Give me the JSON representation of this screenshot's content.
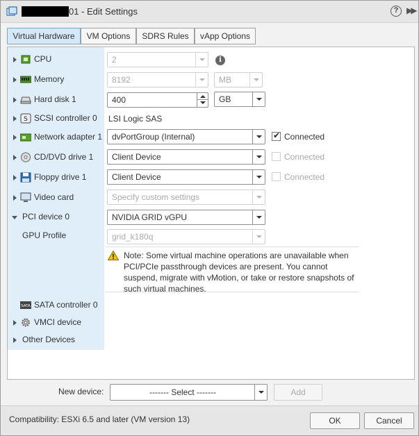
{
  "window": {
    "title": "01 - Edit Settings"
  },
  "tabs": [
    {
      "label": "Virtual Hardware",
      "active": true
    },
    {
      "label": "VM Options",
      "active": false
    },
    {
      "label": "SDRS Rules",
      "active": false
    },
    {
      "label": "vApp Options",
      "active": false
    }
  ],
  "hardware": {
    "cpu": {
      "label": "CPU",
      "value": "2"
    },
    "memory": {
      "label": "Memory",
      "value": "8192",
      "unit": "MB"
    },
    "hard_disk": {
      "label": "Hard disk 1",
      "value": "400",
      "unit": "GB"
    },
    "scsi": {
      "label": "SCSI controller 0",
      "value": "LSI Logic SAS"
    },
    "network": {
      "label": "Network adapter 1",
      "value": "dvPortGroup (Internal)",
      "connected_label": "Connected",
      "connected": true
    },
    "cdrom": {
      "label": "CD/DVD drive 1",
      "value": "Client Device",
      "connected_label": "Connected",
      "connected": false
    },
    "floppy": {
      "label": "Floppy drive 1",
      "value": "Client Device",
      "connected_label": "Connected",
      "connected": false
    },
    "video": {
      "label": "Video card",
      "value": "Specify custom settings"
    },
    "pci": {
      "label": "PCI device 0",
      "value": "NVIDIA GRID vGPU"
    },
    "gpu_profile": {
      "label": "GPU Profile",
      "value": "grid_k180q"
    },
    "note": "Note: Some virtual machine operations are unavailable when PCI/PCIe passthrough devices are present. You cannot suspend, migrate with vMotion, or take or restore snapshots of such virtual machines.",
    "sata": {
      "label": "SATA controller 0"
    },
    "vmci": {
      "label": "VMCI device"
    },
    "other": {
      "label": "Other Devices"
    }
  },
  "new_device": {
    "label": "New device:",
    "select_value": "------- Select -------",
    "add_label": "Add"
  },
  "footer": {
    "compatibility": "Compatibility: ESXi 6.5 and later (VM version 13)",
    "ok_label": "OK",
    "cancel_label": "Cancel"
  },
  "icons": {
    "help": "help-icon",
    "expand": "expand-icon",
    "info": "info-icon",
    "warning": "warning-icon"
  },
  "colors": {
    "label_column": "#dfeef9",
    "active_tab": "#d5e8f7"
  }
}
